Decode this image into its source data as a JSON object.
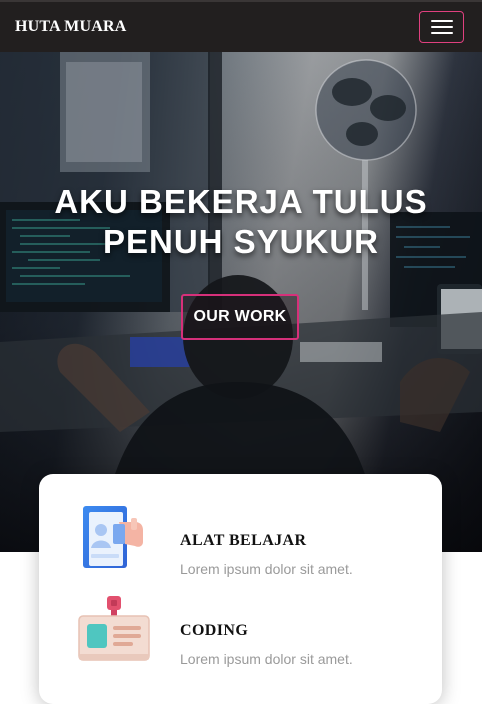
{
  "navbar": {
    "brand": "HUTA MUARA",
    "toggle_icon": "hamburger-icon",
    "accent_color": "#e0407f"
  },
  "hero": {
    "title_line1": "AKU BEKERJA TULUS",
    "title_line2": "PENUH SYUKUR",
    "button_label": "OUR WORK"
  },
  "features": [
    {
      "title": "ALAT BELAJAR",
      "description": "Lorem ipsum dolor sit amet.",
      "icon": "presentation-board-icon"
    },
    {
      "title": "CODING",
      "description": "Lorem ipsum dolor sit amet.",
      "icon": "id-badge-icon"
    }
  ]
}
